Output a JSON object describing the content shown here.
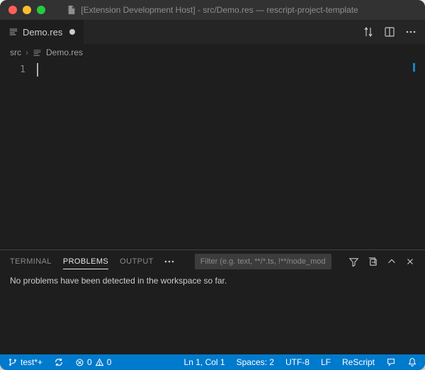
{
  "window": {
    "title": "[Extension Development Host] - src/Demo.res — rescript-project-template"
  },
  "tabs": {
    "items": [
      {
        "label": "Demo.res"
      }
    ]
  },
  "breadcrumb": {
    "folder": "src",
    "file": "Demo.res"
  },
  "editor": {
    "line_number": "1",
    "content": ""
  },
  "panel": {
    "tabs": {
      "terminal": "TERMINAL",
      "problems": "PROBLEMS",
      "output": "OUTPUT"
    },
    "filter_placeholder": "Filter (e.g. text, **/*.ts, !**/node_modules/**)",
    "body": "No problems have been detected in the workspace so far."
  },
  "status": {
    "branch": "test*+",
    "sync": "",
    "errors": "0",
    "warnings": "0",
    "cursor": "Ln 1, Col 1",
    "spaces": "Spaces: 2",
    "encoding": "UTF-8",
    "eol": "LF",
    "language": "ReScript"
  }
}
